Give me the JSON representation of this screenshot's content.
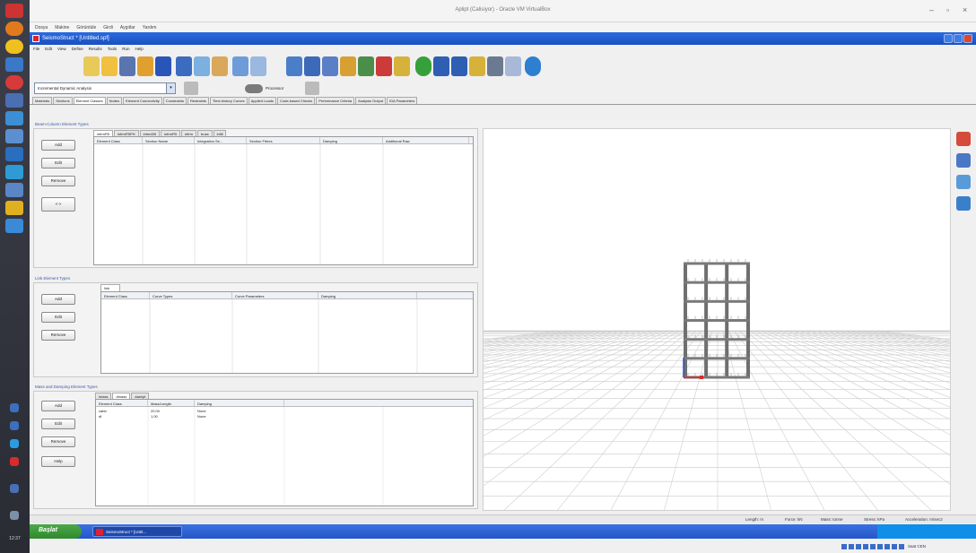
{
  "host": {
    "title": "Aplipt (Calisiyor) - Oracle VM VirtualBox",
    "menu": [
      "Dosya",
      "Makine",
      "Görüntüle",
      "Girdi",
      "Aygıtlar",
      "Yardım"
    ],
    "clock": "12:37",
    "tray_text": "Saat CEN"
  },
  "app": {
    "title": "SeismoStruct * [Untitled.spf]",
    "menu": [
      "File",
      "Edit",
      "View",
      "Define",
      "Results",
      "Tools",
      "Run",
      "Help"
    ],
    "analysis_type": "Incremental Dynamic Analysis",
    "buttons": {
      "btn1": "",
      "processor": "Processor",
      "btn3": ""
    }
  },
  "main_tabs": [
    {
      "label": "Materials",
      "active": false
    },
    {
      "label": "Sections",
      "active": false
    },
    {
      "label": "Element Classes",
      "active": true
    },
    {
      "label": "Nodes",
      "active": false
    },
    {
      "label": "Element Connectivity",
      "active": false
    },
    {
      "label": "Constraints",
      "active": false
    },
    {
      "label": "Restraints",
      "active": false
    },
    {
      "label": "Time-history Curves",
      "active": false
    },
    {
      "label": "Applied Loads",
      "active": false
    },
    {
      "label": "Code-based Checks",
      "active": false
    },
    {
      "label": "Performance Criteria",
      "active": false
    },
    {
      "label": "Analysis Output",
      "active": false
    },
    {
      "label": "IDA Parameters",
      "active": false
    }
  ],
  "beam_column": {
    "title": "Beam-Column Element Types",
    "buttons": [
      "Add",
      "Edit",
      "Remove",
      "<->"
    ],
    "tabs": [
      {
        "label": "infrmFB",
        "active": true
      },
      {
        "label": "infrmFBPH",
        "active": false
      },
      {
        "label": "infrmDB",
        "active": false
      },
      {
        "label": "infrmFB",
        "active": false
      },
      {
        "label": "elfrm",
        "active": false
      },
      {
        "label": "truss",
        "active": false
      },
      {
        "label": "infill",
        "active": false
      }
    ],
    "columns": [
      "Element Class",
      "Section Name",
      "Integration Se...",
      "Section Fibres",
      "Damping",
      "Additional Raw"
    ]
  },
  "link": {
    "title": "Link Element Types",
    "buttons": [
      "Add",
      "Edit",
      "Remove"
    ],
    "tabs": [
      {
        "label": "link",
        "active": true
      }
    ],
    "columns": [
      "Element Class",
      "Curve Types",
      "Curve Parameters",
      "Damping"
    ]
  },
  "mass": {
    "title": "Mass and Damping Element Types",
    "buttons": [
      "Add",
      "Edit",
      "Remove",
      "Help"
    ],
    "tabs": [
      {
        "label": "lmass",
        "active": false
      },
      {
        "label": "dmass",
        "active": true
      },
      {
        "label": "dashpt",
        "active": false
      }
    ],
    "columns": [
      "Element Class",
      "Mass/Length",
      "Damping"
    ],
    "rows": [
      [
        "cabb",
        "20.00",
        "None"
      ],
      [
        "df",
        "1.00",
        "None"
      ]
    ]
  },
  "status": {
    "length": "Length: m",
    "force": "Force: kN",
    "mass": "Mass: tonne",
    "stress": "Stress: kPa",
    "acceleration": "Acceleration: m/sec2"
  },
  "taskbar": {
    "start": "Başlat",
    "item": "SeismoStruct * [Untit..."
  },
  "colors": {
    "title_blue": "#1a4fc0",
    "start_green": "#2f8a2e",
    "section_title": "#3a5ba8"
  }
}
